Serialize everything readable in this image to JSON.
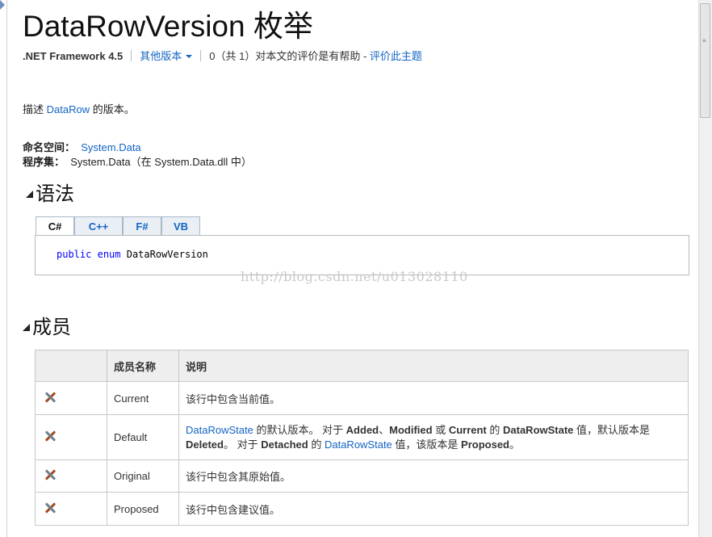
{
  "page": {
    "title": "DataRowVersion 枚举",
    "framework": ".NET Framework 4.5",
    "other_versions": "其他版本",
    "rating_text": "0（共 1）对本文的评价是有帮助 - ",
    "rate_link": "评价此主题"
  },
  "description": {
    "prefix": "描述 ",
    "link": "DataRow",
    "suffix": " 的版本。"
  },
  "namespace": {
    "ns_label": "命名空间：",
    "ns_value": "System.Data",
    "asm_label": "程序集：",
    "asm_value": "System.Data（在 System.Data.dll 中）"
  },
  "syntax": {
    "heading": "语法",
    "tabs": [
      "C#",
      "C++",
      "F#",
      "VB"
    ],
    "code_kw1": "public",
    "code_kw2": "enum",
    "code_name": "DataRowVersion"
  },
  "watermark": "http://blog.csdn.net/u013028110",
  "members": {
    "heading": "成员",
    "col_name": "成员名称",
    "col_desc": "说明",
    "rows": [
      {
        "name": "Current",
        "desc": "该行中包含当前值。"
      },
      {
        "name": "Default",
        "d1": "DataRowState",
        "d2": " 的默认版本。 对于 ",
        "d3": "Added",
        "d4": "、",
        "d5": "Modified",
        "d6": " 或 ",
        "d7": "Current",
        "d8": " 的 ",
        "d9": "DataRowState",
        "d10": " 值，默认版本是 ",
        "d11": "Deleted",
        "d12": "。 对于 ",
        "d13": "Detached",
        "d14": " 的 ",
        "d15": "DataRowState",
        "d16": " 值，该版本是 ",
        "d17": "Proposed",
        "d18": "。"
      },
      {
        "name": "Original",
        "desc": "该行中包含其原始值。"
      },
      {
        "name": "Proposed",
        "desc": "该行中包含建议值。"
      }
    ]
  }
}
